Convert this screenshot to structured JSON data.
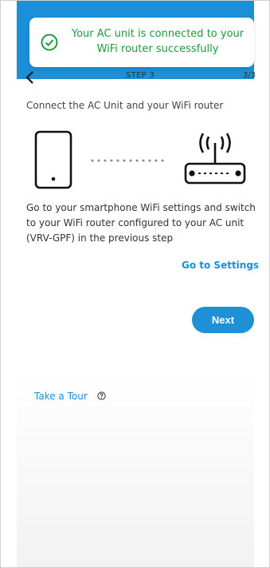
{
  "toast": {
    "icon": "check-circle-icon",
    "message": "Your AC unit is connected to your WiFi router successfully",
    "color": "#1e9a3e"
  },
  "header": {
    "back_icon": "chevron-left-icon",
    "step_label": "STEP 3",
    "step_count": "3/3"
  },
  "main": {
    "heading": "Connect the AC Unit and your WiFi router",
    "illustration": {
      "left_icon": "smartphone-icon",
      "right_icon": "wifi-router-icon"
    },
    "description": "Go to your smartphone WiFi settings and switch to your WiFi router configured to your AC unit (VRV-GPF) in the previous step",
    "settings_link": "Go to Settings",
    "next_label": "Next",
    "tour_label": "Take a Tour",
    "tour_icon": "help-circle-icon"
  },
  "colors": {
    "accent": "#1b8fd8",
    "success": "#1e9a3e"
  }
}
